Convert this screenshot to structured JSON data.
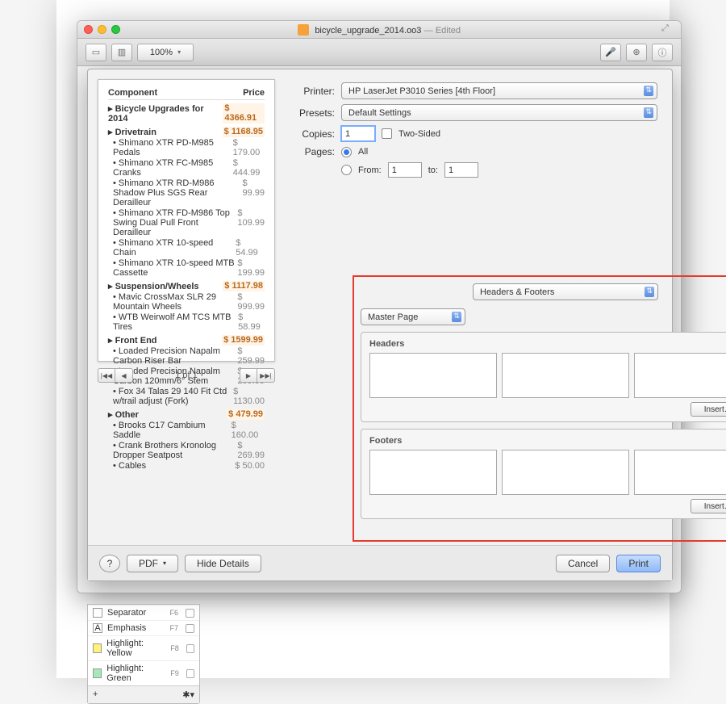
{
  "window": {
    "filename": "bicycle_upgrade_2014.oo3",
    "edited": "— Edited",
    "zoom": "100%"
  },
  "preview": {
    "col_component": "Component",
    "col_price": "Price",
    "title": "Bicycle Upgrades for 2014",
    "title_price": "$ 4366.91",
    "sections": [
      {
        "name": "Drivetrain",
        "price": "$ 1168.95",
        "items": [
          {
            "n": "Shimano XTR PD-M985 Pedals",
            "p": "$ 179.00"
          },
          {
            "n": "Shimano XTR FC-M985 Cranks",
            "p": "$ 444.99"
          },
          {
            "n": "Shimano XTR RD-M986 Shadow Plus SGS Rear Derailleur",
            "p": "$ 99.99"
          },
          {
            "n": "Shimano XTR FD-M986 Top Swing Dual Pull Front Derailleur",
            "p": "$ 109.99"
          },
          {
            "n": "Shimano XTR 10-speed Chain",
            "p": "$ 54.99"
          },
          {
            "n": "Shimano XTR 10-speed MTB Cassette",
            "p": "$ 199.99"
          }
        ]
      },
      {
        "name": "Suspension/Wheels",
        "price": "$ 1117.98",
        "items": [
          {
            "n": "Mavic CrossMax SLR 29 Mountain Wheels",
            "p": "$ 999.99"
          },
          {
            "n": "WTB Weirwolf AM TCS MTB Tires",
            "p": "$ 58.99"
          }
        ]
      },
      {
        "name": "Front End",
        "price": "$ 1599.99",
        "items": [
          {
            "n": "Loaded Precision Napalm Carbon Riser Bar",
            "p": "$ 259.99"
          },
          {
            "n": "Loaded Precision Napalm Carbon 120mm/6° Stem",
            "p": "$ 209.99"
          },
          {
            "n": "Fox 34 Talas 29 140 Fit Ctd w/trail adjust (Fork)",
            "p": "$ 1130.00"
          }
        ]
      },
      {
        "name": "Other",
        "price": "$ 479.99",
        "items": [
          {
            "n": "Brooks C17 Cambium Saddle",
            "p": "$ 160.00"
          },
          {
            "n": "Crank Brothers Kronolog Dropper Seatpost",
            "p": "$ 269.99"
          },
          {
            "n": "Cables",
            "p": "$ 50.00"
          }
        ]
      }
    ],
    "nav": {
      "first": "|◀◀",
      "prev": "◀",
      "page": "1 of 1",
      "next": "▶",
      "last": "▶▶|"
    }
  },
  "print": {
    "printer_label": "Printer:",
    "printer_value": "HP LaserJet P3010 Series [4th Floor]",
    "presets_label": "Presets:",
    "presets_value": "Default Settings",
    "copies_label": "Copies:",
    "copies_value": "1",
    "two_sided": "Two-Sided",
    "pages_label": "Pages:",
    "all": "All",
    "from": "From:",
    "from_v": "1",
    "to": "to:",
    "to_v": "1",
    "section_select": "Headers & Footers",
    "page_scope": "Master Page",
    "headers_label": "Headers",
    "footers_label": "Footers",
    "insert": "Insert…"
  },
  "buttons": {
    "help": "?",
    "pdf": "PDF",
    "hide": "Hide Details",
    "cancel": "Cancel",
    "print": "Print"
  },
  "styles": {
    "rows": [
      {
        "sw": "#fff",
        "n": "Separator",
        "k": "F6"
      },
      {
        "sw": "A",
        "n": "Emphasis",
        "k": "F7"
      },
      {
        "sw": "#fff27a",
        "n": "Highlight: Yellow",
        "k": "F8"
      },
      {
        "sw": "#a6e8b8",
        "n": "Highlight: Green",
        "k": "F9"
      }
    ],
    "add": "+",
    "gear": "✱▾"
  }
}
